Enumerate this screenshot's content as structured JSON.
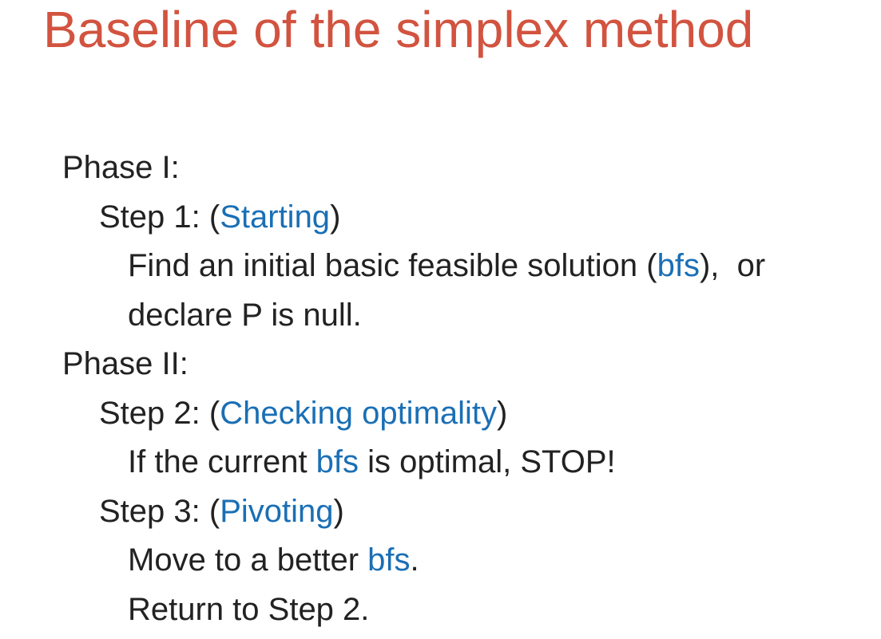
{
  "title": "Baseline of the simplex method",
  "phase1": {
    "label": "Phase I:",
    "step1": {
      "prefix": "Step 1: (",
      "name": "Starting",
      "suffix": ")",
      "line1_a": "Find an initial basic feasible solution (",
      "line1_term": "bfs",
      "line1_b": "),  or",
      "line2": "declare P is null."
    }
  },
  "phase2": {
    "label": "Phase II:",
    "step2": {
      "prefix": "Step 2: (",
      "name": "Checking optimality",
      "suffix": ")",
      "line1_a": "If the current ",
      "line1_term": "bfs",
      "line1_b": " is optimal, STOP!"
    },
    "step3": {
      "prefix": "Step 3: (",
      "name": "Pivoting",
      "suffix": ")",
      "line1_a": "Move to a better ",
      "line1_term": "bfs",
      "line1_b": ".",
      "line2": "Return to Step 2."
    }
  },
  "colors": {
    "title": "#d2533f",
    "highlight": "#1a6fb5",
    "text": "#222222"
  }
}
